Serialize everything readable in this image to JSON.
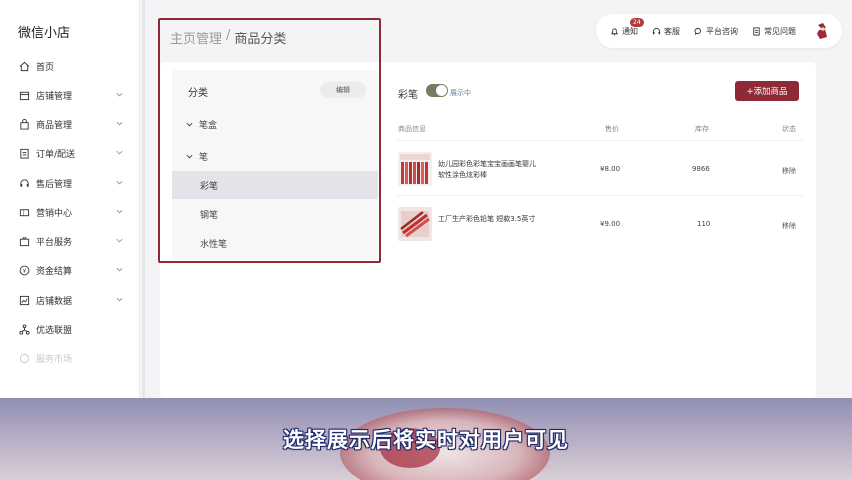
{
  "sidebar": {
    "brand": "微信小店",
    "items": [
      {
        "label": "首页",
        "icon": "home-icon",
        "chevron": false
      },
      {
        "label": "店铺管理",
        "icon": "shop-icon",
        "chevron": true
      },
      {
        "label": "商品管理",
        "icon": "bag-icon",
        "chevron": true
      },
      {
        "label": "订单/配送",
        "icon": "order-icon",
        "chevron": true
      },
      {
        "label": "售后管理",
        "icon": "headset-icon",
        "chevron": true
      },
      {
        "label": "营销中心",
        "icon": "ticket-icon",
        "chevron": true
      },
      {
        "label": "平台服务",
        "icon": "briefcase-icon",
        "chevron": true
      },
      {
        "label": "资金结算",
        "icon": "money-icon",
        "chevron": true
      },
      {
        "label": "店铺数据",
        "icon": "chart-icon",
        "chevron": true
      },
      {
        "label": "优选联盟",
        "icon": "network-icon",
        "chevron": false
      },
      {
        "label": "服务市场",
        "icon": "market-icon",
        "chevron": false
      }
    ]
  },
  "topbar": {
    "notification_label": "通知",
    "notification_badge": "24",
    "service_label": "客服",
    "consult_label": "平台咨询",
    "faq_label": "常见问题"
  },
  "breadcrumb": {
    "parent": "主页管理",
    "separator": "/",
    "current": "商品分类"
  },
  "category_panel": {
    "title": "分类",
    "edit_label": "编辑",
    "groups": [
      {
        "label": "笔盒",
        "children": []
      },
      {
        "label": "笔",
        "children": [
          "彩笔",
          "钢笔",
          "水性笔"
        ]
      }
    ],
    "selected": "彩笔"
  },
  "content": {
    "category_name": "彩笔",
    "toggle_label": "展示中",
    "toggle_on": true,
    "add_button": "+添加商品",
    "columns": [
      "商品信息",
      "售价",
      "库存",
      "状态"
    ],
    "products": [
      {
        "name": "幼儿园彩色彩笔宝宝画画笔婴儿软性涂色炫彩棒",
        "price": "¥8.00",
        "stock": "9866",
        "action": "移除"
      },
      {
        "name": "工厂生产彩色铅笔 短款3.5英寸",
        "price": "¥9.00",
        "stock": "110",
        "action": "移除"
      }
    ]
  },
  "subtitle": "选择展示后将实时对用户可见",
  "colors": {
    "accent": "#8e2a36",
    "highlight_border": "#8e2a36"
  }
}
